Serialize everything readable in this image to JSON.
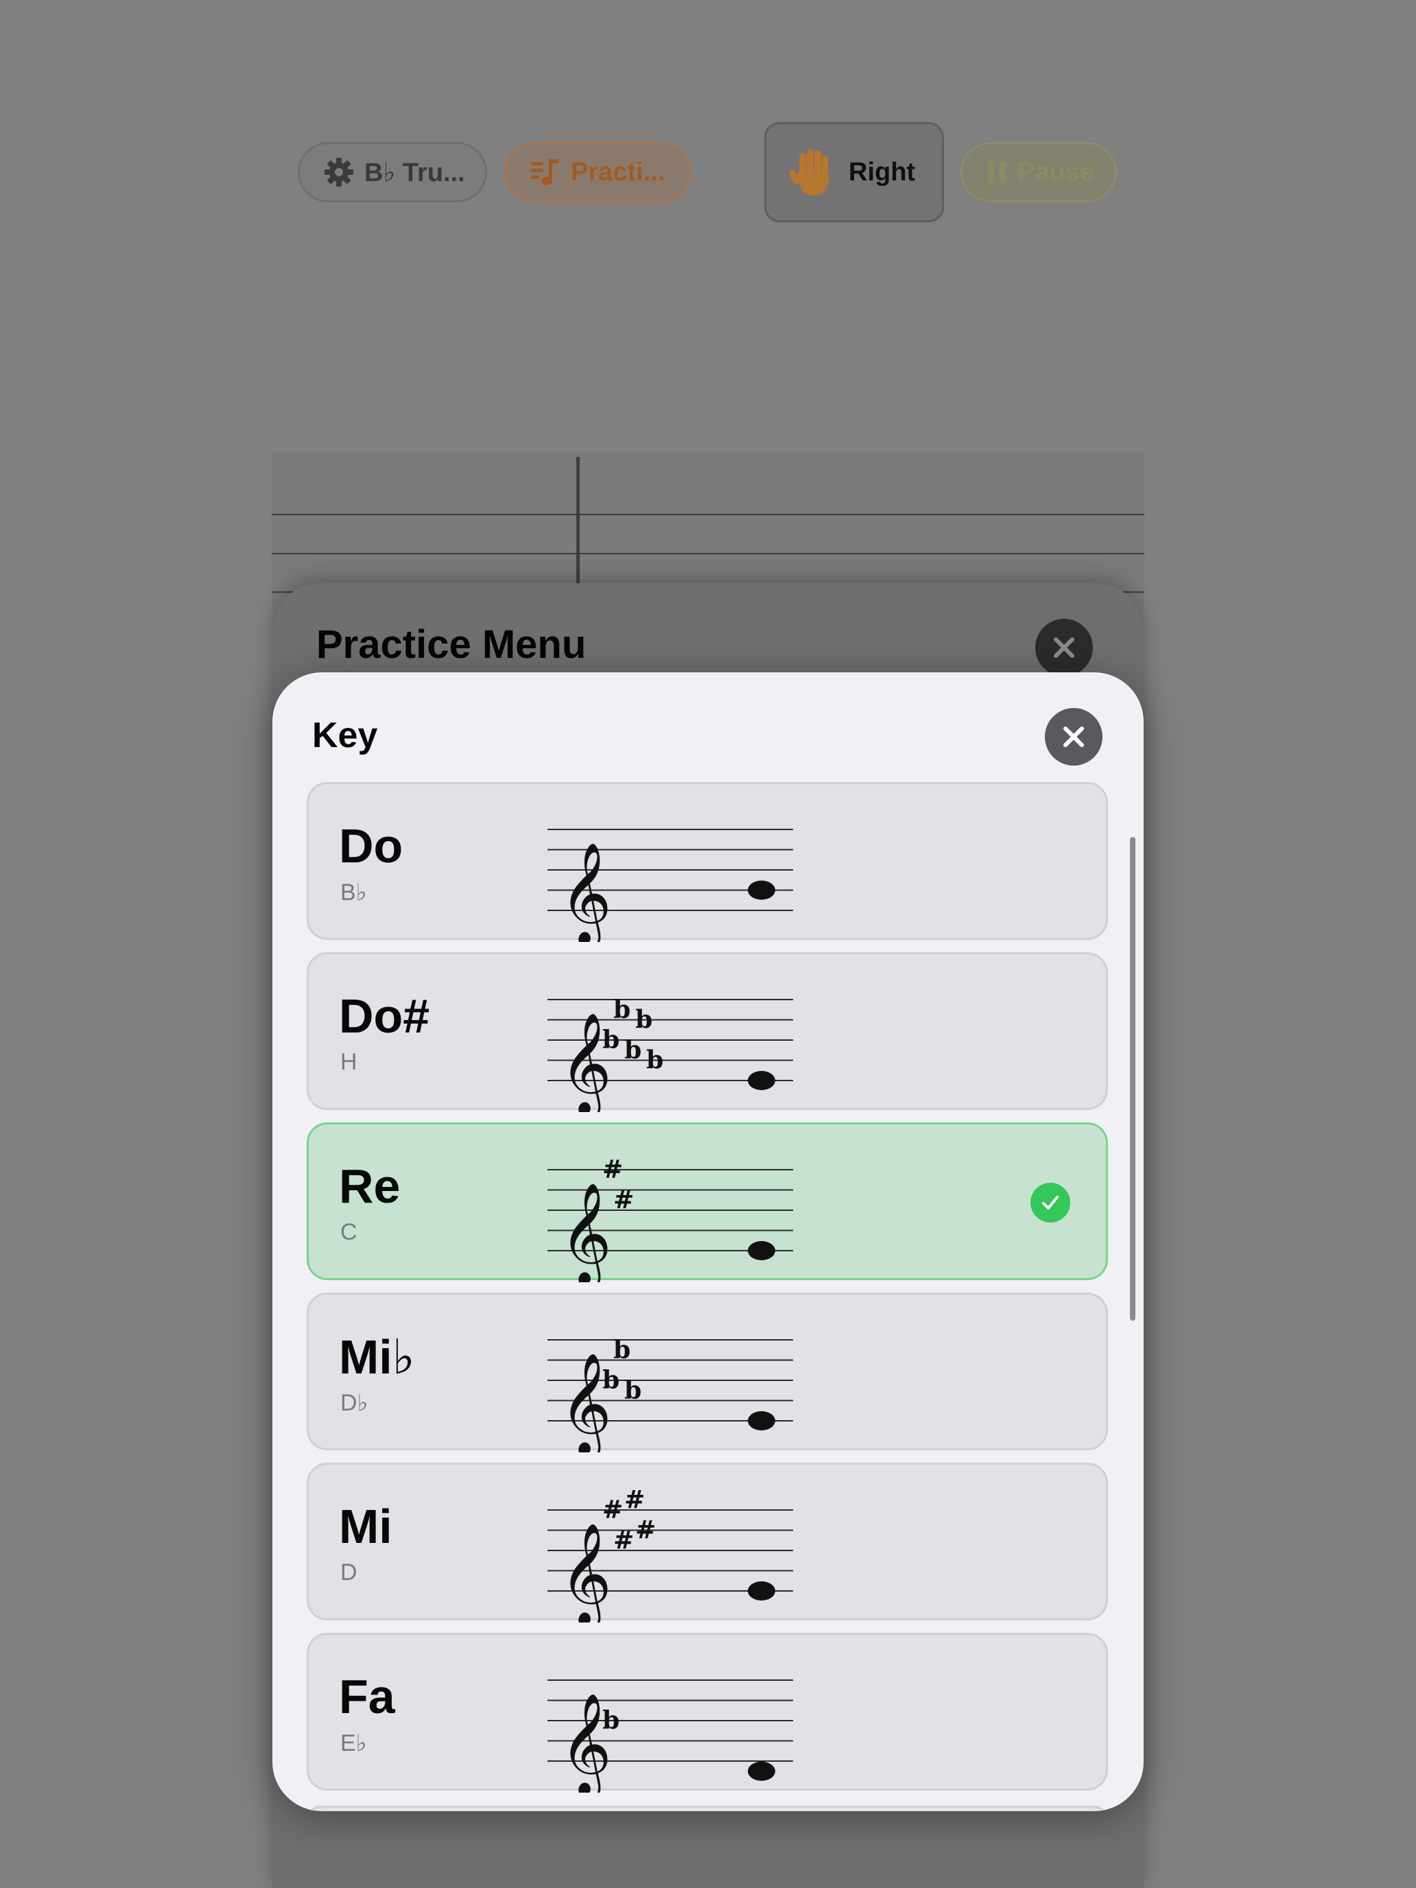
{
  "toolbar": {
    "instrument_label": "B♭ Tru...",
    "practice_label": "Practi...",
    "hand_label": "Right",
    "pause_label": "Pause"
  },
  "practice_menu": {
    "title": "Practice Menu"
  },
  "key_modal": {
    "title": "Key",
    "selected_index": 2,
    "options": [
      {
        "name": "Do",
        "sub": "B♭",
        "accidental": "none",
        "count": 0,
        "note_step": -2
      },
      {
        "name": "Do#",
        "sub": "H",
        "accidental": "flat",
        "count": 5,
        "note_step": 0
      },
      {
        "name": "Re",
        "sub": "C",
        "accidental": "sharp",
        "count": 2,
        "note_step": 0
      },
      {
        "name": "Mi♭",
        "sub": "D♭",
        "accidental": "flat",
        "count": 3,
        "note_step": 0
      },
      {
        "name": "Mi",
        "sub": "D",
        "accidental": "sharp",
        "count": 4,
        "note_step": 0
      },
      {
        "name": "Fa",
        "sub": "E♭",
        "accidental": "flat",
        "count": 1,
        "note_step": 1
      }
    ]
  },
  "colors": {
    "accent_green": "#34c759",
    "selected_row": "#c7e2d0",
    "practice_orange": "#a45a23"
  },
  "icons": {
    "instrument": "gear-icon",
    "practice": "music-list-icon",
    "hand": "raised-hand-icon",
    "pause": "pause-icon",
    "close": "close-icon",
    "selected": "checkmark-icon"
  }
}
